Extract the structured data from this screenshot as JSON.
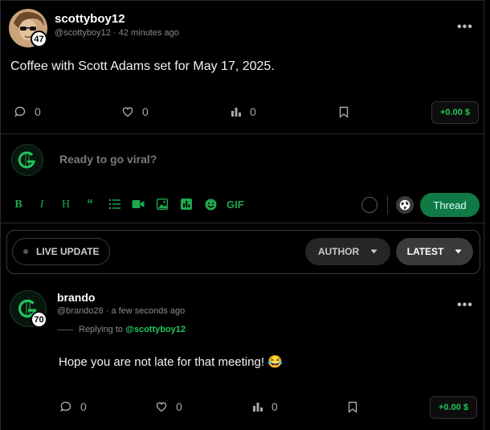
{
  "post": {
    "username": "scottyboy12",
    "handle": "@scottyboy12",
    "time": "42 minutes ago",
    "level": "47",
    "text": "Coffee with Scott Adams set for May 17, 2025.",
    "comments": "0",
    "likes": "0",
    "views": "0",
    "tip": "+0.00 $"
  },
  "composer": {
    "placeholder": "Ready to go viral?",
    "gif_label": "GIF",
    "thread_label": "Thread",
    "accent": "#22c55e"
  },
  "filters": {
    "live_label": "LIVE UPDATE",
    "author_label": "AUTHOR",
    "latest_label": "LATEST"
  },
  "reply": {
    "username": "brando",
    "handle": "@brando28",
    "time": "a few seconds ago",
    "level": "70",
    "replying_prefix": "Replying to",
    "replying_to": "@scottyboy12",
    "text": "Hope you are not late for that meeting! 😂",
    "comments": "0",
    "likes": "0",
    "views": "0",
    "tip": "+0.00 $"
  },
  "icons": {
    "comment": "comment-icon",
    "like": "heart-icon",
    "views": "bar-chart-icon",
    "bookmark": "bookmark-icon",
    "more": "more-dots-icon"
  }
}
